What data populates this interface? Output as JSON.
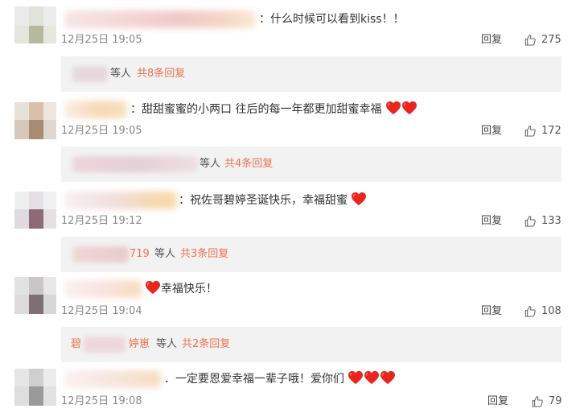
{
  "comments": [
    {
      "text": "：什么时候可以看到kiss！！",
      "time": "12月25日 19:05",
      "reply_label": "回复",
      "likes": "275",
      "hearts": 0,
      "thread": {
        "who": "等人",
        "count": "共8条回复"
      }
    },
    {
      "text": "：甜甜蜜蜜的小两口 往后的每一年都更加甜蜜幸福",
      "time": "12月25日 19:05",
      "reply_label": "回复",
      "likes": "172",
      "hearts": 2,
      "thread": {
        "who": "等人",
        "count": "共4条回复"
      }
    },
    {
      "text": "：祝佐哥碧婷圣诞快乐，幸福甜蜜",
      "time": "12月25日 19:12",
      "reply_label": "回复",
      "likes": "133",
      "hearts": 1,
      "thread": {
        "prefix": "719",
        "who": "等人",
        "count": "共3条回复"
      }
    },
    {
      "text": "幸福快乐！",
      "time": "12月25日 19:04",
      "reply_label": "回复",
      "likes": "108",
      "hearts": 1,
      "thread": {
        "prefix_a": "碧",
        "prefix_b": "婷崽",
        "who": "等人",
        "count": "共2条回复"
      }
    },
    {
      "text": "．一定要恩爱幸福一辈子哦！爱你们",
      "time": "12月25日 19:08",
      "reply_label": "回复",
      "likes": "79",
      "hearts": 3
    }
  ],
  "colors": {
    "heart": "#e8261f",
    "reply_count": "#eb7350",
    "reply_bg": "#f2f2f2"
  },
  "icons": {
    "like": "thumbs-up-icon",
    "heart": "heart-icon"
  }
}
